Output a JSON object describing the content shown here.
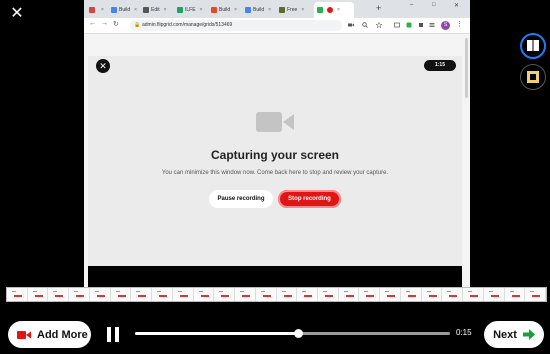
{
  "overlay": {
    "close_glyph": "✕"
  },
  "browser": {
    "tabs": [
      {
        "label": "",
        "favicon_color": "#d44638",
        "icon": "gmail-icon"
      },
      {
        "label": "Build",
        "favicon_color": "#4285f4",
        "icon": "doc-icon"
      },
      {
        "label": "Edit",
        "favicon_color": "#555555",
        "icon": "globe-icon"
      },
      {
        "label": "ILFE",
        "favicon_color": "#1da462",
        "icon": "sheet-icon"
      },
      {
        "label": "Build",
        "favicon_color": "#e34c26",
        "icon": "app-icon"
      },
      {
        "label": "Build",
        "favicon_color": "#4285f4",
        "icon": "doc-icon"
      },
      {
        "label": "Free",
        "favicon_color": "#5a6b2a",
        "icon": "site-icon"
      },
      {
        "label": "",
        "favicon_color": "#2ab24b",
        "icon": "flipgrid-icon",
        "active": true
      }
    ],
    "new_tab_glyph": "+",
    "url": "admin.flipgrid.com/manage/grids/513469",
    "profile_initial": "S"
  },
  "recorder": {
    "counter": "1:15",
    "title": "Capturing your screen",
    "subtitle": "You can minimize this window now. Come back here to stop and review your capture.",
    "pause_label": "Pause recording",
    "stop_label": "Stop recording"
  },
  "controls": {
    "add_more_label": "Add More",
    "next_label": "Next",
    "time": "0:15",
    "progress": 0.52,
    "thumb_count": 26
  },
  "colors": {
    "accent_red": "#e01515",
    "accent_blue": "#1e7cf2",
    "next_arrow": "#1a9e3a"
  }
}
